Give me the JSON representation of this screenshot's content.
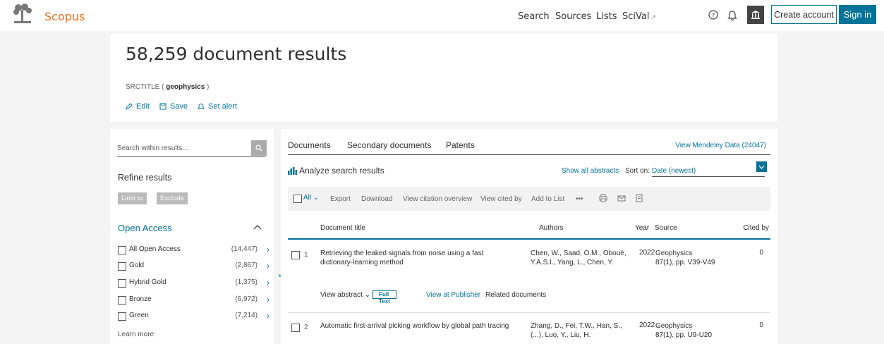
{
  "header": {
    "brand": "Scopus",
    "nav": [
      "Search",
      "Sources",
      "Lists",
      "SciVal"
    ],
    "nav_ext": "↗",
    "create_account": "Create account",
    "sign_in": "Sign in"
  },
  "results": {
    "title": "58,259 document results",
    "query_field": "SRCTITLE (",
    "query_term": "geophysics",
    "query_close": ")",
    "actions": {
      "edit": "Edit",
      "save": "Save",
      "alert": "Set alert"
    }
  },
  "refine": {
    "search_placeholder": "Search within results...",
    "title": "Refine results",
    "limit_to": "Limit to",
    "exclude": "Exclude",
    "open_access_title": "Open Access",
    "facets": [
      {
        "label": "All Open Access",
        "count": "(14,447)"
      },
      {
        "label": "Gold",
        "count": "(2,867)"
      },
      {
        "label": "Hybrid Gold",
        "count": "(1,375)"
      },
      {
        "label": "Bronze",
        "count": "(6,972)"
      },
      {
        "label": "Green",
        "count": "(7,214)"
      }
    ],
    "learn_more": "Learn more"
  },
  "main": {
    "tabs": [
      "Documents",
      "Secondary documents",
      "Patents"
    ],
    "mendeley": "View Mendeley Data (24047)",
    "analyze": "Analyze search results",
    "show_abstracts": "Show all abstracts",
    "sort_label": "Sort on:",
    "sort_value": "Date (newest)",
    "toolbar": {
      "all": "All",
      "export": "Export",
      "download": "Download",
      "citation_overview": "View citation overview",
      "cited_by": "View cited by",
      "add_to_list": "Add to List",
      "more": "•••"
    },
    "columns": {
      "title": "Document title",
      "authors": "Authors",
      "year": "Year",
      "source": "Source",
      "cited": "Cited by"
    },
    "rows": [
      {
        "num": "1",
        "title": "Retrieving the leaked signals from noise using a fast dictionary-learning method",
        "authors": "Chen, W., Saad, O.M., Oboué, Y.A.S.I., Yang, L., Chen, Y.",
        "year": "2022",
        "source": "Geophysics",
        "source_detail": "87(1), pp. V39-V49",
        "cited": "0"
      },
      {
        "num": "2",
        "title": "Automatic first-arrival picking workflow by global path tracing",
        "authors": "Zhang, D., Fei, T.W., Han, S., (...), Luo, Y., Liu, H.",
        "year": "2022",
        "source": "Geophysics",
        "source_detail": "87(1), pp. U9-U20",
        "cited": "0"
      }
    ],
    "row_actions": {
      "view_abstract": "View abstract",
      "full_text": "Full Text",
      "view_publisher": "View at Publisher",
      "related": "Related documents"
    }
  }
}
